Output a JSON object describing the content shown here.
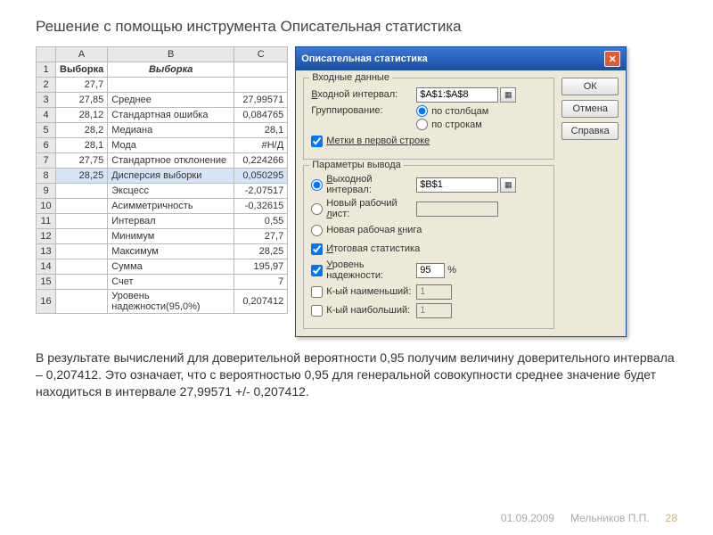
{
  "page": {
    "title": "Решение с помощью инструмента Описательная статистика",
    "body_text": "В результате вычислений для доверительной вероятности 0,95 получим величину доверительного интервала – 0,207412. Это означает, что с вероятностью 0,95 для генеральной совокупности среднее значение будет находиться в интервале 27,99571 +/- 0,207412.",
    "date": "01.09.2009",
    "author": "Мельников П.П.",
    "pageno": "28"
  },
  "sheet": {
    "cols": [
      "A",
      "B",
      "C"
    ],
    "header0": "Выборка",
    "header1": "Выборка",
    "rows": [
      {
        "n": "2",
        "a": "27,7",
        "b": "",
        "c": ""
      },
      {
        "n": "3",
        "a": "27,85",
        "b": "Среднее",
        "c": "27,99571"
      },
      {
        "n": "4",
        "a": "28,12",
        "b": "Стандартная ошибка",
        "c": "0,084765"
      },
      {
        "n": "5",
        "a": "28,2",
        "b": "Медиана",
        "c": "28,1"
      },
      {
        "n": "6",
        "a": "28,1",
        "b": "Мода",
        "c": "#Н/Д"
      },
      {
        "n": "7",
        "a": "27,75",
        "b": "Стандартное отклонение",
        "c": "0,224266"
      },
      {
        "n": "8",
        "a": "28,25",
        "b": "Дисперсия выборки",
        "c": "0,050295"
      },
      {
        "n": "9",
        "a": "",
        "b": "Эксцесс",
        "c": "-2,07517"
      },
      {
        "n": "10",
        "a": "",
        "b": "Асимметричность",
        "c": "-0,32615"
      },
      {
        "n": "11",
        "a": "",
        "b": "Интервал",
        "c": "0,55"
      },
      {
        "n": "12",
        "a": "",
        "b": "Минимум",
        "c": "27,7"
      },
      {
        "n": "13",
        "a": "",
        "b": "Максимум",
        "c": "28,25"
      },
      {
        "n": "14",
        "a": "",
        "b": "Сумма",
        "c": "195,97"
      },
      {
        "n": "15",
        "a": "",
        "b": "Счет",
        "c": "7"
      },
      {
        "n": "16",
        "a": "",
        "b": "Уровень надежности(95,0%)",
        "c": "0,207412"
      }
    ]
  },
  "dialog": {
    "title": "Описательная статистика",
    "group_input": "Входные данные",
    "lbl_input_range": "Входной интервал:",
    "val_input_range": "$A$1:$A$8",
    "lbl_grouping": "Группирование:",
    "radio_cols": "по столбцам",
    "radio_rows": "по строкам",
    "chk_labels": "Метки в первой строке",
    "group_output": "Параметры вывода",
    "radio_out_range": "Выходной интервал:",
    "val_out_range": "$B$1",
    "radio_new_sheet": "Новый рабочий лист:",
    "radio_new_book": "Новая рабочая книга",
    "chk_summary": "Итоговая статистика",
    "chk_confidence": "Уровень надежности:",
    "val_confidence": "95",
    "pct": "%",
    "chk_kth_small": "К-ый наименьший:",
    "chk_kth_large": "К-ый наибольший:",
    "val_kth": "1",
    "btn_ok": "ОК",
    "btn_cancel": "Отмена",
    "btn_help": "Справка"
  }
}
